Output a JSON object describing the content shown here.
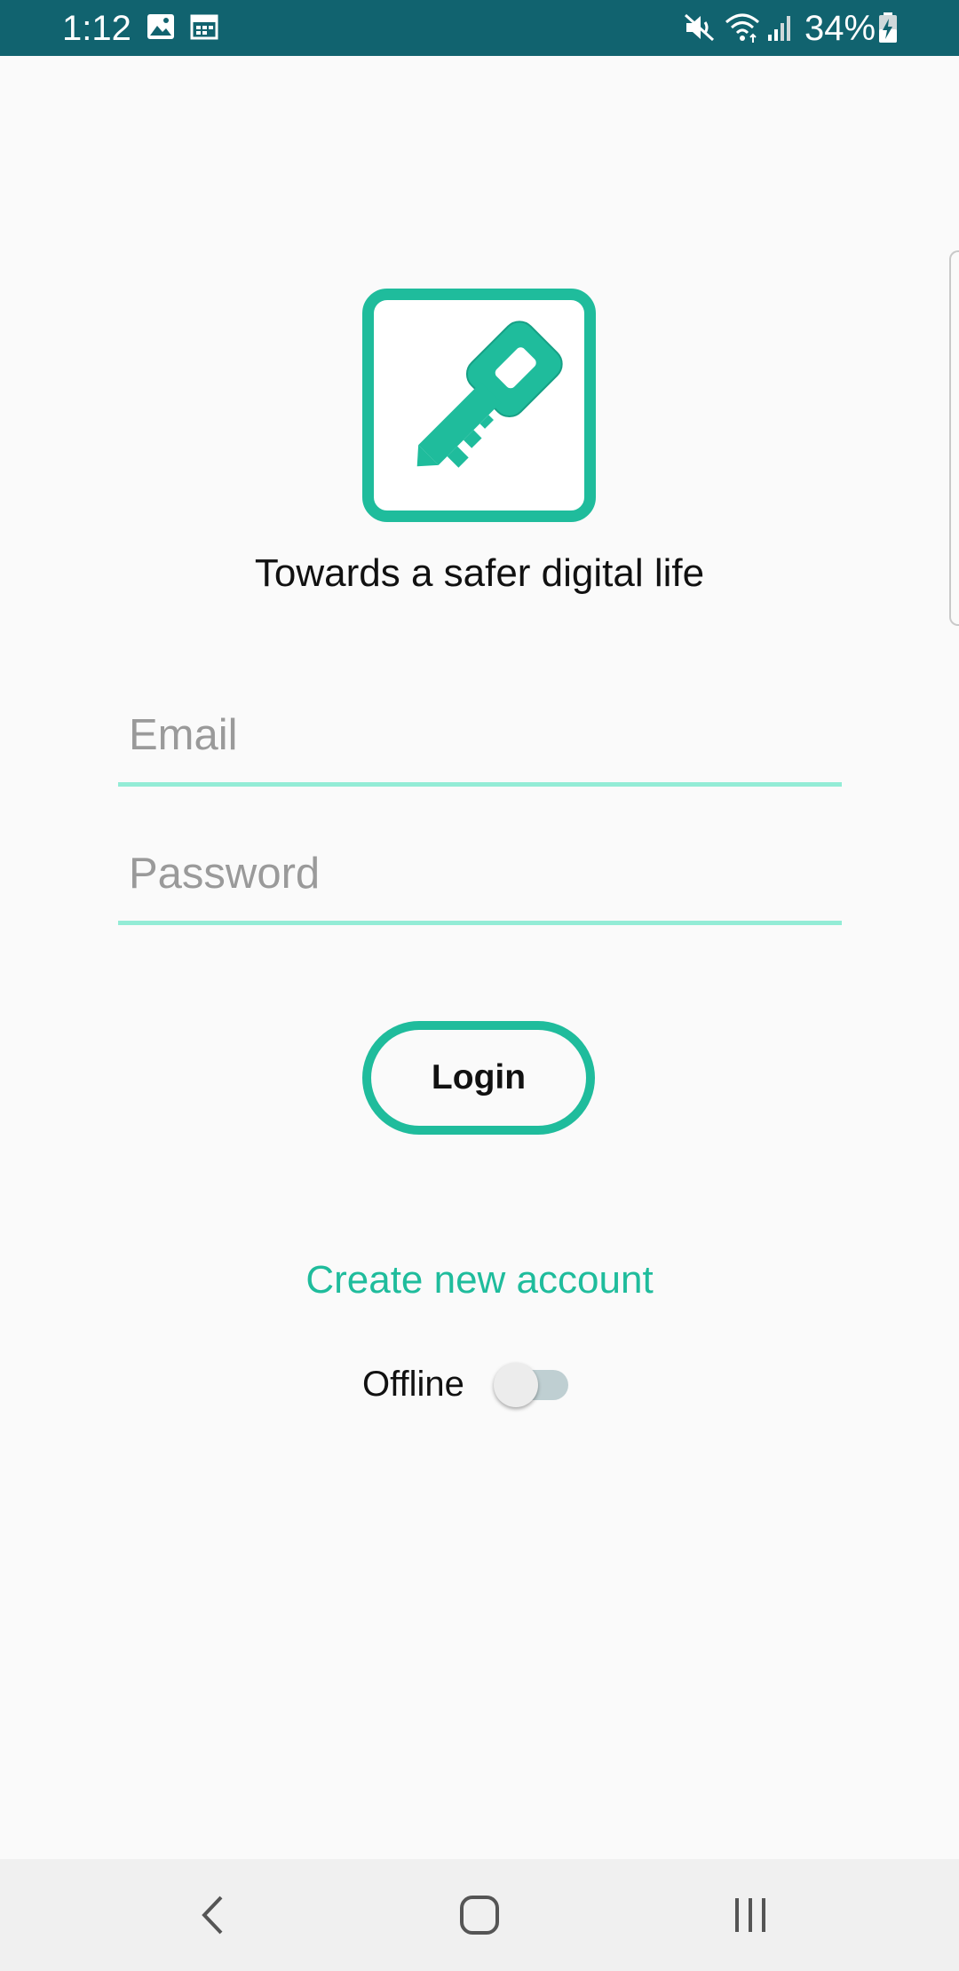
{
  "status_bar": {
    "time": "1:12",
    "battery_text": "34%",
    "icons": [
      "image-icon",
      "calendar-icon",
      "mute-icon",
      "wifi-icon",
      "signal-icon",
      "battery-charging-icon"
    ]
  },
  "branding": {
    "logo_icon": "key-icon",
    "tagline": "Towards a safer digital life"
  },
  "form": {
    "email_placeholder": "Email",
    "email_value": "",
    "password_placeholder": "Password",
    "password_value": "",
    "login_label": "Login"
  },
  "links": {
    "create_account": "Create new account"
  },
  "offline": {
    "label": "Offline",
    "enabled": false
  },
  "nav_bar": {
    "icons": [
      "back-icon",
      "home-icon",
      "recents-icon"
    ]
  },
  "colors": {
    "status_bar": "#11636f",
    "accent": "#1fbc9c",
    "input_underline": "#93ecd6",
    "background": "#fafafa"
  }
}
